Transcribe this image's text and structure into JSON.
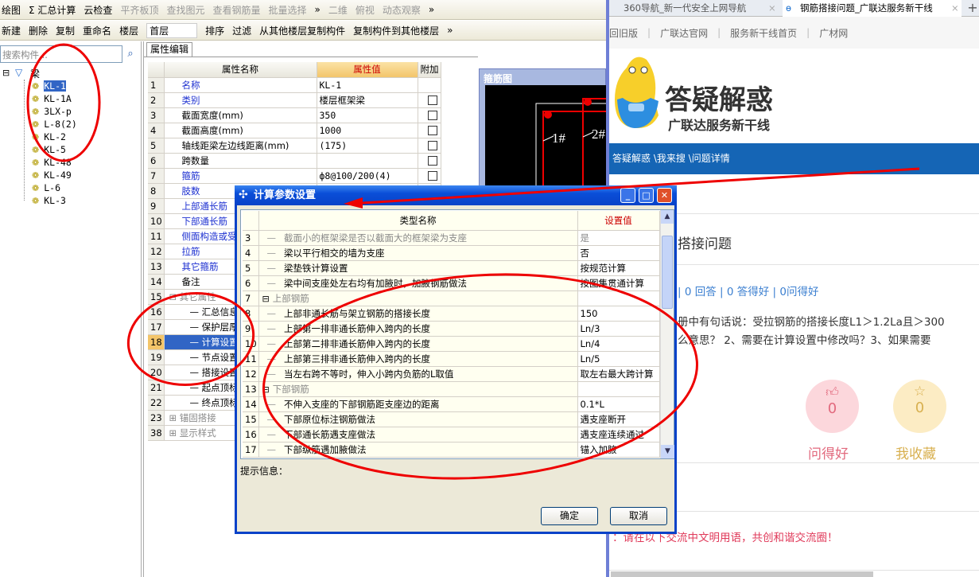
{
  "toolbar1": {
    "items": [
      "绘图",
      "Σ 汇总计算",
      "云检查",
      "平齐板顶",
      "查找图元",
      "查看钢筋量",
      "批量选择",
      "»",
      "二维",
      "俯视",
      "动态观察",
      "»"
    ]
  },
  "toolbar2": {
    "items": [
      "新建",
      "删除",
      "复制",
      "重命名",
      "楼层"
    ],
    "floor": "首层",
    "items2": [
      "排序",
      "过滤",
      "从其他楼层复制构件",
      "复制构件到其他楼层",
      "»"
    ]
  },
  "search": {
    "placeholder": "搜索构件..."
  },
  "tree": {
    "root": "梁",
    "items": [
      "KL-1",
      "KL-1A",
      "3LX-p",
      "L-8(2)",
      "KL-2",
      "KL-5",
      "KL-48",
      "KL-49",
      "L-6",
      "KL-3"
    ],
    "selected": "KL-1"
  },
  "props": {
    "tab": "属性编辑",
    "headers": [
      "属性名称",
      "属性值",
      "附加"
    ],
    "rows": [
      {
        "n": "1",
        "name": "名称",
        "value": "KL-1",
        "blue": true,
        "chk": false
      },
      {
        "n": "2",
        "name": "类别",
        "value": "楼层框架梁",
        "blue": true,
        "chk": true
      },
      {
        "n": "3",
        "name": "截面宽度(mm)",
        "value": "350",
        "chk": true
      },
      {
        "n": "4",
        "name": "截面高度(mm)",
        "value": "1000",
        "chk": true
      },
      {
        "n": "5",
        "name": "轴线距梁左边线距离(mm)",
        "value": "(175)",
        "chk": true
      },
      {
        "n": "6",
        "name": "跨数量",
        "value": "",
        "chk": true
      },
      {
        "n": "7",
        "name": "箍筋",
        "value": "ф8@100/200(4)",
        "blue": true,
        "chk": true
      },
      {
        "n": "8",
        "name": "肢数",
        "value": "",
        "blue": true
      },
      {
        "n": "9",
        "name": "上部通长筋",
        "value": "",
        "blue": true
      },
      {
        "n": "10",
        "name": "下部通长筋",
        "value": "",
        "blue": true
      },
      {
        "n": "11",
        "name": "侧面构造或受",
        "value": "",
        "blue": true
      },
      {
        "n": "12",
        "name": "拉筋",
        "value": "",
        "blue": true
      },
      {
        "n": "13",
        "name": "其它箍筋",
        "value": "",
        "blue": true
      },
      {
        "n": "14",
        "name": "备注",
        "value": ""
      },
      {
        "n": "15",
        "name": "⊟ 其它属性",
        "value": "",
        "gray": true
      },
      {
        "n": "16",
        "name": "— 汇总信息",
        "value": "",
        "indent": true
      },
      {
        "n": "17",
        "name": "— 保护层厚度",
        "value": "",
        "indent": true
      },
      {
        "n": "18",
        "name": "— 计算设置",
        "value": "",
        "indent": true,
        "sel": true
      },
      {
        "n": "19",
        "name": "— 节点设置",
        "value": "",
        "indent": true
      },
      {
        "n": "20",
        "name": "— 搭接设置",
        "value": "",
        "indent": true
      },
      {
        "n": "21",
        "name": "— 起点顶标高",
        "value": "",
        "indent": true
      },
      {
        "n": "22",
        "name": "— 终点顶标高",
        "value": "",
        "indent": true
      },
      {
        "n": "23",
        "name": "⊞ 锚固搭接",
        "value": "",
        "gray": true
      },
      {
        "n": "38",
        "name": "⊞ 显示样式",
        "value": "",
        "gray": true
      }
    ]
  },
  "rebar_panel": {
    "title": "箍筋图",
    "labels": [
      "1#",
      "2#"
    ]
  },
  "dialog": {
    "title": "计算参数设置",
    "headers": [
      "类型名称",
      "设置值"
    ],
    "rows": [
      {
        "n": "3",
        "name": "截面小的框架梁是否以截面大的框架梁为支座",
        "value": "是",
        "gray": true
      },
      {
        "n": "4",
        "name": "梁以平行相交的墙为支座",
        "value": "否"
      },
      {
        "n": "5",
        "name": "梁垫铁计算设置",
        "value": "按规范计算"
      },
      {
        "n": "6",
        "name": "梁中间支座处左右均有加腋时，加腋钢筋做法",
        "value": "按图集贯通计算"
      },
      {
        "n": "7",
        "name": "上部钢筋",
        "value": "",
        "group": true
      },
      {
        "n": "8",
        "name": "上部非通长筋与架立钢筋的搭接长度",
        "value": "150"
      },
      {
        "n": "9",
        "name": "上部第一排非通长筋伸入跨内的长度",
        "value": "Ln/3"
      },
      {
        "n": "10",
        "name": "上部第二排非通长筋伸入跨内的长度",
        "value": "Ln/4"
      },
      {
        "n": "11",
        "name": "上部第三排非通长筋伸入跨内的长度",
        "value": "Ln/5"
      },
      {
        "n": "12",
        "name": "当左右跨不等时，伸入小跨内负筋的L取值",
        "value": "取左右最大跨计算"
      },
      {
        "n": "13",
        "name": "下部钢筋",
        "value": "",
        "group": true
      },
      {
        "n": "14",
        "name": "不伸入支座的下部钢筋距支座边的距离",
        "value": "0.1*L"
      },
      {
        "n": "15",
        "name": "下部原位标注钢筋做法",
        "value": "遇支座断开"
      },
      {
        "n": "16",
        "name": "下部通长筋遇支座做法",
        "value": "遇支座连续通过"
      },
      {
        "n": "17",
        "name": "下部纵筋遇加腋做法",
        "value": "锚入加腋"
      }
    ],
    "info_label": "提示信息：",
    "ok": "确定",
    "cancel": "取消"
  },
  "browser": {
    "tabs": [
      "360导航_新一代安全上网导航",
      "钢筋搭接问题_广联达服务新干线"
    ],
    "nav": [
      "回旧版",
      "广联达官网",
      "服务新干线首页",
      "广材网"
    ],
    "logo_title": "答疑解惑",
    "logo_sub": "广联达服务新干线",
    "breadcrumb": "答疑解惑 \\我来搜 \\问题详情",
    "question_title": "搭接问题",
    "stats": "| 0 回答 | 0 答得好 | 0问得好",
    "body1": "册中有句话说：受拉钢筋的搭接长度L1＞1.2La且＞300",
    "body2": "么意思？ 2、需要在计算设置中修改吗？3、如果需要",
    "good_count": "0",
    "good_label": "问得好",
    "fav_count": "0",
    "fav_label": "我收藏",
    "notice": "：请在以下交流中文明用语，共创和谐交流圈！"
  },
  "colors": {
    "accent": "#0842c8",
    "annotation": "#e00000",
    "header_value": "#f3c56a",
    "banner": "#1565b5"
  }
}
